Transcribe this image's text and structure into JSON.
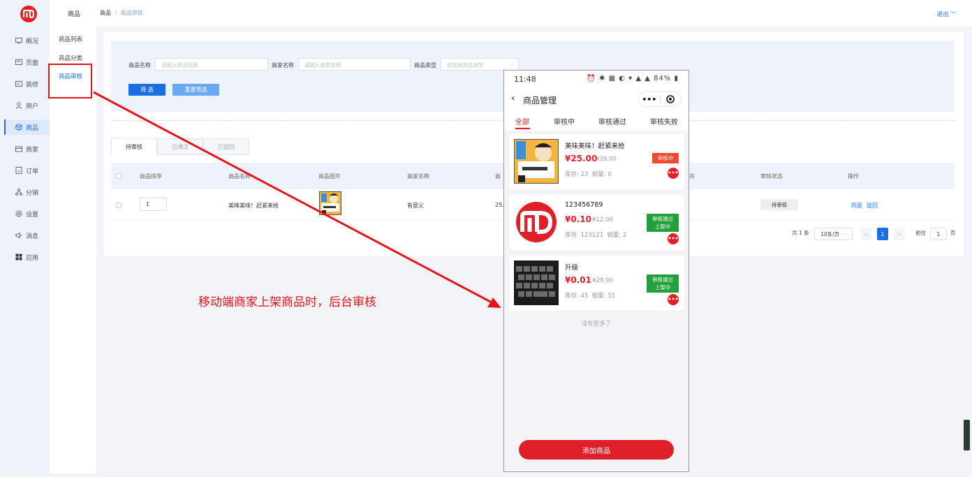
{
  "nav": {
    "items": [
      {
        "label": "概况",
        "icon": "monitor-icon"
      },
      {
        "label": "页面",
        "icon": "page-icon"
      },
      {
        "label": "装修",
        "icon": "decorate-icon"
      },
      {
        "label": "用户",
        "icon": "user-icon"
      },
      {
        "label": "商品",
        "icon": "cube-icon",
        "active": true
      },
      {
        "label": "商家",
        "icon": "store-icon"
      },
      {
        "label": "订单",
        "icon": "order-icon"
      },
      {
        "label": "分销",
        "icon": "share-icon"
      },
      {
        "label": "设置",
        "icon": "gear-icon"
      },
      {
        "label": "消息",
        "icon": "speaker-icon"
      },
      {
        "label": "应用",
        "icon": "grid-icon"
      }
    ]
  },
  "subnav": {
    "title": "商品",
    "items": [
      {
        "label": "商品列表"
      },
      {
        "label": "商品分类"
      },
      {
        "label": "商品审核",
        "active": true
      }
    ]
  },
  "topbar": {
    "breadcrumb_root": "商品",
    "breadcrumb_sep": "/",
    "breadcrumb_current": "商品审核",
    "logout": "退出 ﹀"
  },
  "filter": {
    "name_label": "商品名称",
    "name_placeholder": "请输入商品名称",
    "merchant_label": "商家名称",
    "merchant_placeholder": "请输入商家名称",
    "type_label": "商品类型",
    "type_placeholder": "请选择商品类型",
    "filter_btn": "筛 选",
    "reset_btn": "重置筛选"
  },
  "tabs": [
    "待审核",
    "已通过",
    "已驳回"
  ],
  "table": {
    "headers": [
      "商品排序",
      "商品名称",
      "商品图片",
      "商家名称",
      "商",
      "存",
      "审核状态",
      "操作"
    ],
    "rows": [
      {
        "sort": "1",
        "name": "美味美味！赶紧来抢",
        "merchant": "有意义",
        "price": "25.",
        "status": "待审核",
        "op1": "同意",
        "op2": "驳回"
      }
    ]
  },
  "pagination": {
    "total": "共 1 条",
    "page_size": "10条/页",
    "prev": "<",
    "current": "1",
    "next": ">",
    "goto_label": "前往",
    "goto_value": "1",
    "goto_suffix": "页"
  },
  "annotation": "移动端商家上架商品时，后台审核",
  "phone": {
    "time": "11:48",
    "status_icons": "⏰ ✱ ▦ ◐ ▾ ▲ ▲ 84% ▮",
    "battery": "84%",
    "title": "商品管理",
    "capsule_dots": "•••",
    "tabs": [
      "全部",
      "审核中",
      "审核通过",
      "审核失败"
    ],
    "products": [
      {
        "name": "美味美味！赶紧来抢",
        "price": "¥25.00",
        "orig": "¥39.00",
        "stock": "库存: 23",
        "sold": "销量: 0",
        "badge": "审核中",
        "badge_color": "#f04b2f"
      },
      {
        "name": "123456789",
        "price": "¥0.10",
        "orig": "¥12.00",
        "stock": "库存: 123121",
        "sold": "销量: 2",
        "badge_line1": "审核通过",
        "badge_line2": "上架中",
        "badge_color": "#23a03a"
      },
      {
        "name": "升级",
        "price": "¥0.01",
        "orig": "¥29.90",
        "stock": "库存: 45",
        "sold": "销量: 55",
        "badge_line1": "审核通过",
        "badge_line2": "上架中",
        "badge_color": "#23a03a"
      }
    ],
    "more_glyph": "•••",
    "no_more": "没有更多了",
    "add_btn": "添加商品"
  },
  "colors": {
    "accent": "#1b6fe0",
    "brand_red": "#e02028",
    "annotation_red": "#e0161b",
    "approved_green": "#23a03a"
  }
}
